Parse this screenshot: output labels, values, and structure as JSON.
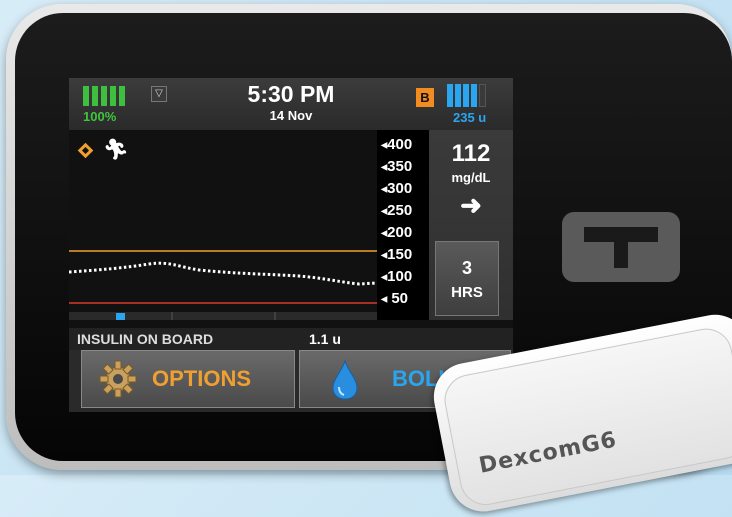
{
  "status": {
    "battery_percent": "100%",
    "time": "5:30 PM",
    "date": "14 Nov",
    "badge": "B",
    "insulin_remaining": "235 u"
  },
  "cgm": {
    "value": "112",
    "unit": "mg/dL",
    "trend": "steady-right-arrow",
    "scale_labels": [
      "400",
      "350",
      "300",
      "250",
      "200",
      "150",
      "100",
      "50"
    ],
    "timeframe_value": "3",
    "timeframe_unit": "HRS"
  },
  "insulin_on_board": {
    "label": "INSULIN ON BOARD",
    "value": "1.1 u"
  },
  "buttons": {
    "options": "OPTIONS",
    "bolus": "BOLUS"
  },
  "sensor": {
    "brand": "DexcomG6"
  },
  "colors": {
    "battery": "#3fbf3f",
    "insulin": "#2aa6f0",
    "high_limit": "#f0a030",
    "low_limit": "#d83a2a",
    "options_text": "#f0a030",
    "bolus_text": "#2aa6f0"
  },
  "icons": [
    "signal-icon",
    "diamond-icon",
    "exercise-icon",
    "trend-arrow-icon",
    "gear-icon",
    "drop-icon",
    "t-logo-icon"
  ]
}
